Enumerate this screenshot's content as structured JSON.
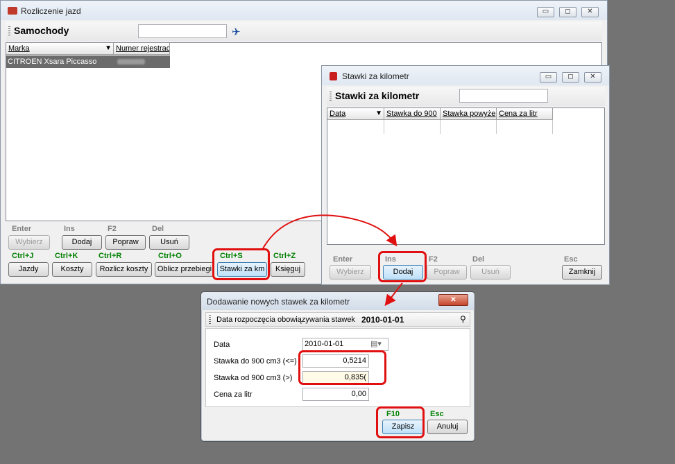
{
  "main_window": {
    "title": "Rozliczenie jazd",
    "panel_title": "Samochody",
    "columns": [
      "Marka",
      "Numer rejestrac"
    ],
    "rows": [
      {
        "marka": "CITROEN Xsara Piccasso"
      }
    ],
    "shortcuts_row1": [
      {
        "key": "Enter",
        "label": "Wybierz"
      },
      {
        "key": "Ins",
        "label": "Dodaj"
      },
      {
        "key": "F2",
        "label": "Popraw"
      },
      {
        "key": "Del",
        "label": "Usuń"
      }
    ],
    "shortcuts_row2": [
      {
        "key": "Ctrl+J",
        "label": "Jazdy"
      },
      {
        "key": "Ctrl+K",
        "label": "Koszty"
      },
      {
        "key": "Ctrl+R",
        "label": "Rozlicz koszty"
      },
      {
        "key": "Ctrl+O",
        "label": "Oblicz przebiegi"
      },
      {
        "key": "Ctrl+S",
        "label": "Stawki za km"
      },
      {
        "key": "Ctrl+Z",
        "label": "Księguj"
      }
    ]
  },
  "rates_window": {
    "title": "Stawki za kilometr",
    "panel_title": "Stawki za kilometr",
    "columns": [
      "Data",
      "Stawka do 900",
      "Stawka powyże",
      "Cena za litr"
    ],
    "shortcuts": [
      {
        "key": "Enter",
        "label": "Wybierz"
      },
      {
        "key": "Ins",
        "label": "Dodaj"
      },
      {
        "key": "F2",
        "label": "Popraw"
      },
      {
        "key": "Del",
        "label": "Usuń"
      },
      {
        "key": "Esc",
        "label": "Zamknij"
      }
    ]
  },
  "dialog": {
    "title": "Dodawanie nowych stawek za kilometr",
    "header_label": "Data rozpoczęcia obowiązywania stawek",
    "header_value": "2010-01-01",
    "fields": [
      {
        "label": "Data",
        "value": "2010-01-01"
      },
      {
        "label": "Stawka do 900 cm3 (<=)",
        "value": "0,5214"
      },
      {
        "label": "Stawka od 900 cm3 (>)",
        "value": "0,835("
      },
      {
        "label": "Cena za litr",
        "value": "0,00"
      }
    ],
    "buttons": [
      {
        "key": "F10",
        "label": "Zapisz"
      },
      {
        "key": "Esc",
        "label": "Anuluj"
      }
    ]
  },
  "caption_buttons": {
    "minimize": "▭",
    "maximize": "◻",
    "close": "✕"
  },
  "colors": {
    "highlight": "#e01010",
    "shortcut_green": "#008000",
    "shortcut_gray": "#808080"
  }
}
